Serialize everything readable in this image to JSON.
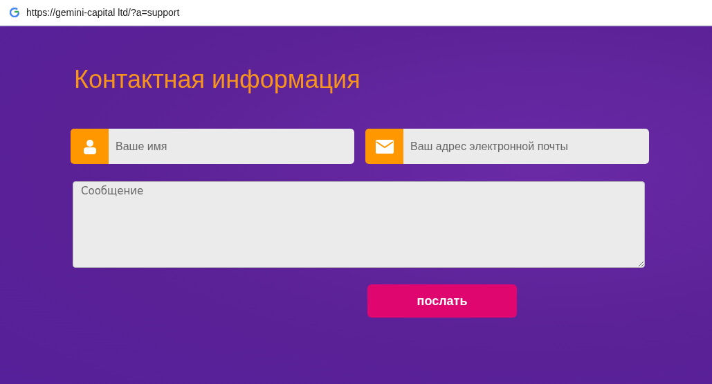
{
  "address_bar": {
    "url": "https://gemini-capital ltd/?a=support"
  },
  "heading": "Контактная информация",
  "fields": [
    {
      "kind": "name",
      "placeholder": "Ваше имя"
    },
    {
      "kind": "email",
      "placeholder": "Ваш адрес электронной почты"
    }
  ],
  "message": {
    "placeholder": "Сообщение"
  },
  "submit_button": "послать"
}
